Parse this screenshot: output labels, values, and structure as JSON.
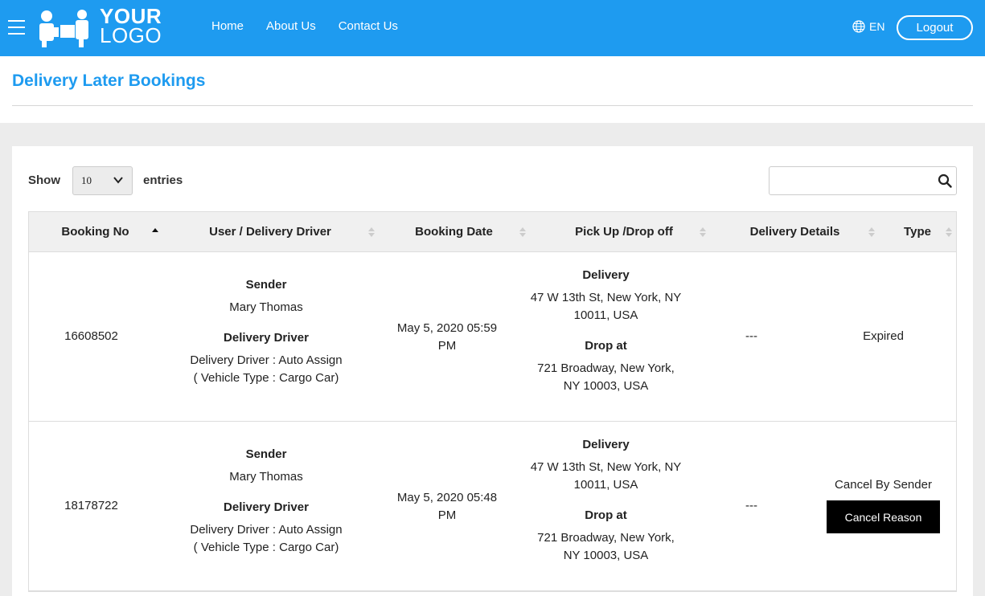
{
  "header": {
    "logo_line1": "YOUR",
    "logo_line2": "LOGO",
    "nav": [
      "Home",
      "About Us",
      "Contact Us"
    ],
    "language": "EN",
    "logout_label": "Logout",
    "brand_color": "#1e9bf0"
  },
  "page_title": "Delivery Later Bookings",
  "controls": {
    "show_label": "Show",
    "page_length": "10",
    "entries_label": "entries",
    "search_value": ""
  },
  "table": {
    "columns": [
      "Booking No",
      "User / Delivery Driver",
      "Booking Date",
      "Pick Up /Drop off",
      "Delivery Details",
      "Type"
    ],
    "rows": [
      {
        "booking_no": "16608502",
        "sender_heading": "Sender",
        "sender_name": "Mary Thomas",
        "driver_heading": "Delivery Driver",
        "driver_assign": "Delivery Driver : Auto Assign",
        "vehicle_type": "( Vehicle Type : Cargo Car)",
        "booking_date_1": "May 5, 2020 05:59",
        "booking_date_2": "PM",
        "pickup_heading": "Delivery",
        "pickup_addr_1": "47 W 13th St, New York, NY",
        "pickup_addr_2": "10011, USA",
        "drop_heading": "Drop at",
        "drop_addr_1": "721 Broadway, New York,",
        "drop_addr_2": "NY 10003, USA",
        "delivery_details": "---",
        "type": "Expired"
      },
      {
        "booking_no": "18178722",
        "sender_heading": "Sender",
        "sender_name": "Mary Thomas",
        "driver_heading": "Delivery Driver",
        "driver_assign": "Delivery Driver : Auto Assign",
        "vehicle_type": "( Vehicle Type : Cargo Car)",
        "booking_date_1": "May 5, 2020 05:48",
        "booking_date_2": "PM",
        "pickup_heading": "Delivery",
        "pickup_addr_1": "47 W 13th St, New York, NY",
        "pickup_addr_2": "10011, USA",
        "drop_heading": "Drop at",
        "drop_addr_1": "721 Broadway, New York,",
        "drop_addr_2": "NY 10003, USA",
        "delivery_details": "---",
        "type": "Cancel By Sender",
        "action_label": "Cancel Reason"
      }
    ]
  }
}
